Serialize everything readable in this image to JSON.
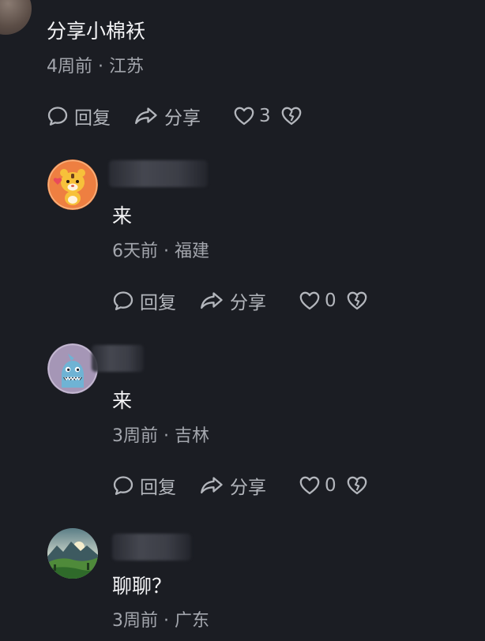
{
  "comments": [
    {
      "text": "分享小棉袄",
      "time": "4周前",
      "location": "江苏",
      "reply_label": "回复",
      "share_label": "分享",
      "likes": "3"
    },
    {
      "text": "来",
      "time": "6天前",
      "location": "福建",
      "reply_label": "回复",
      "share_label": "分享",
      "likes": "0"
    },
    {
      "text": "来",
      "time": "3周前",
      "location": "吉林",
      "reply_label": "回复",
      "share_label": "分享",
      "likes": "0"
    },
    {
      "text": "聊聊？",
      "time": "3周前",
      "location": "广东"
    }
  ],
  "meta_separator": "·",
  "colors": {
    "background": "#1b1d23",
    "text_primary": "#f4f4f6",
    "text_secondary": "#a3a6ad",
    "action": "#b3b6bc"
  },
  "icons": [
    "comment-bubble-icon",
    "share-arrow-icon",
    "heart-icon",
    "broken-heart-icon"
  ]
}
